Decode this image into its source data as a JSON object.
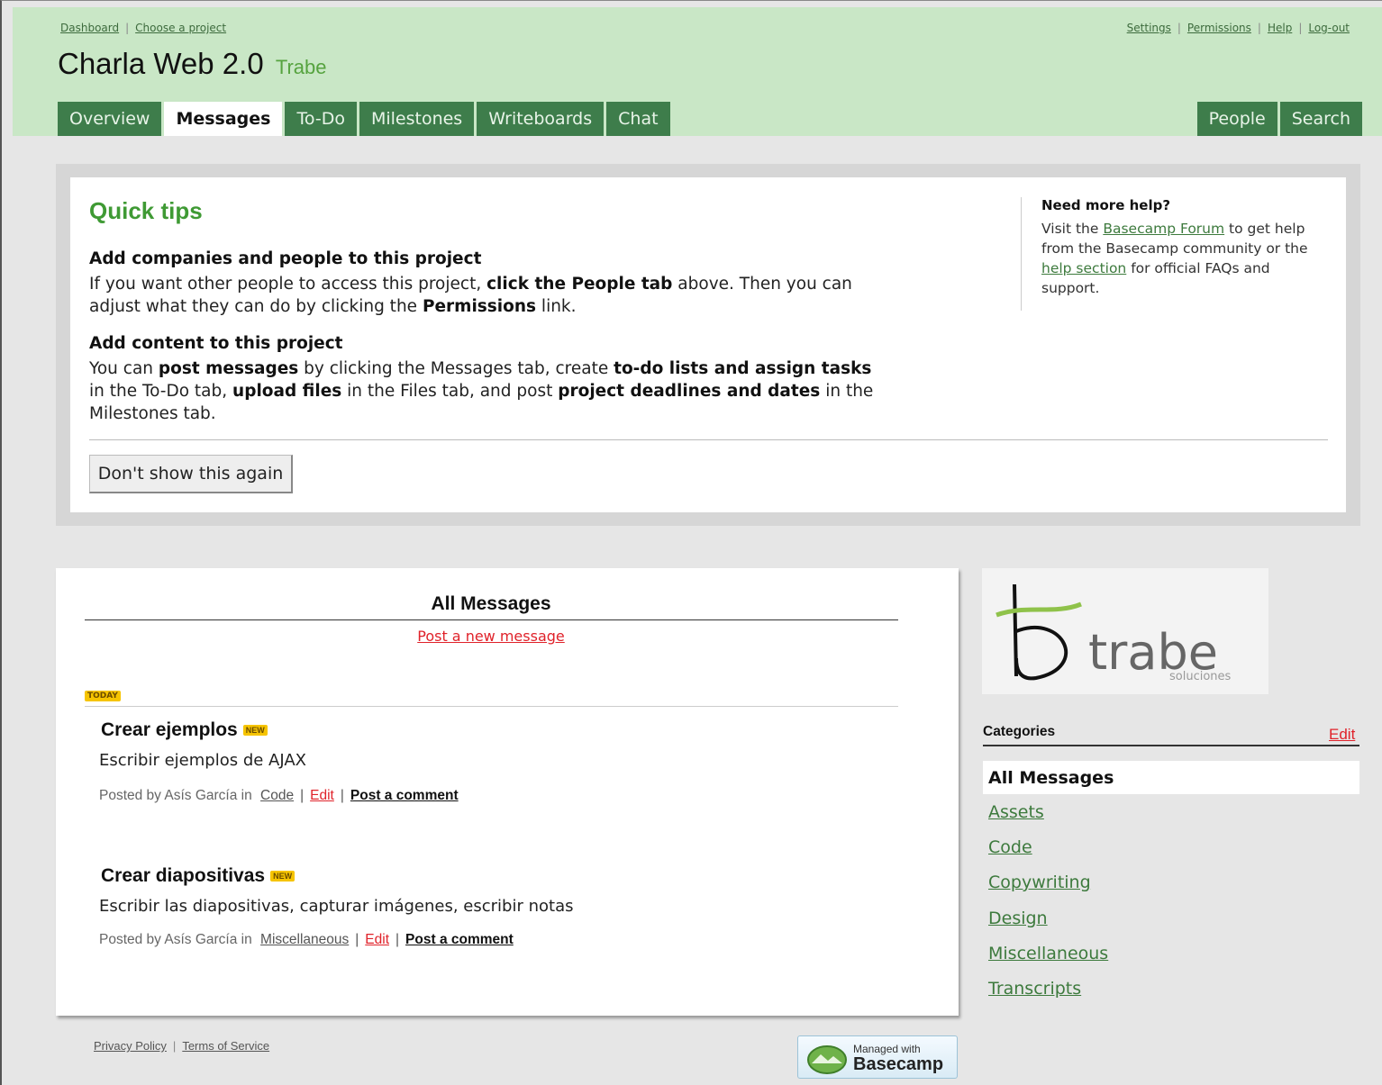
{
  "header": {
    "left_links": [
      "Dashboard",
      "Choose a project"
    ],
    "right_links": [
      "Settings",
      "Permissions",
      "Help",
      "Log-out"
    ],
    "project_title": "Charla Web 2.0",
    "company": "Trabe",
    "tabs": [
      "Overview",
      "Messages",
      "To-Do",
      "Milestones",
      "Writeboards",
      "Chat"
    ],
    "active_tab": "Messages",
    "right_tabs": [
      "People",
      "Search"
    ]
  },
  "tips": {
    "title": "Quick tips",
    "section1_head": "Add companies and people to this project",
    "section1_a": "If you want other people to access this project, ",
    "section1_b": "click the People tab",
    "section1_c": " above. Then you can adjust what they can do by clicking the ",
    "section1_d": "Permissions",
    "section1_e": " link.",
    "section2_head": "Add content to this project",
    "section2_a": "You can ",
    "section2_b": "post messages",
    "section2_c": " by clicking the Messages tab, create ",
    "section2_d": "to-do lists and assign tasks",
    "section2_e": " in the To-Do tab, ",
    "section2_f": "upload files",
    "section2_g": " in the Files tab, and post ",
    "section2_h": "project deadlines and dates",
    "section2_i": " in the Milestones tab.",
    "dont_show_label": "Don't show this again",
    "help_title": "Need more help?",
    "help_a": "Visit the ",
    "help_link1": "Basecamp Forum",
    "help_b": " to get help from the Basecamp community or the ",
    "help_link2": "help section",
    "help_c": " for official FAQs and support."
  },
  "messages": {
    "title": "All Messages",
    "post_new": "Post a new message",
    "today_label": "TODAY",
    "new_label": "NEW",
    "posted_by_prefix": "Posted by Asís García in",
    "edit_label": "Edit",
    "comment_label": "Post a comment",
    "items": [
      {
        "title": "Crear ejemplos",
        "body": "Escribir ejemplos de AJAX",
        "category": "Code"
      },
      {
        "title": "Crear diapositivas",
        "body": "Escribir las diapositivas, capturar imágenes, escribir notas",
        "category": "Miscellaneous"
      }
    ]
  },
  "sidebar": {
    "logo_text": "trabe",
    "logo_sub": "soluciones",
    "categories_label": "Categories",
    "edit_label": "Edit",
    "active_category": "All Messages",
    "categories": [
      "Assets",
      "Code",
      "Copywriting",
      "Design",
      "Miscellaneous",
      "Transcripts"
    ]
  },
  "footer": {
    "links": [
      "Privacy Policy",
      "Terms of Service"
    ],
    "badge_small": "Managed with",
    "badge_big": "Basecamp"
  },
  "colors": {
    "header_bg": "#c9e7c6",
    "tab_bg": "#3e7d4b",
    "tips_title": "#3f9a34",
    "link_red": "#e0222a",
    "link_green": "#3d7a3d",
    "badge_yellow": "#f6c400"
  }
}
